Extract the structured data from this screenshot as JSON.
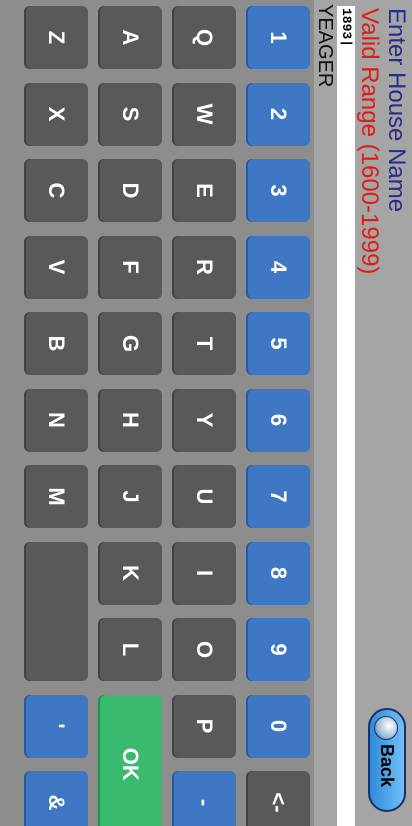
{
  "prompt": {
    "title": "Enter House Name",
    "range": "Valid Range (1600-1999)"
  },
  "entry": {
    "value": "1893|"
  },
  "result": "YEAGER",
  "back_label": "Back",
  "keys": {
    "num": [
      "1",
      "2",
      "3",
      "4",
      "5",
      "6",
      "7",
      "8",
      "9",
      "0"
    ],
    "backspace": "<-",
    "row_q": [
      "Q",
      "W",
      "E",
      "R",
      "T",
      "Y",
      "U",
      "I",
      "O",
      "P"
    ],
    "minus": "-",
    "row_a": [
      "A",
      "S",
      "D",
      "F",
      "G",
      "H",
      "J",
      "K",
      "L"
    ],
    "ok": "OK",
    "row_z": [
      "Z",
      "X",
      "C",
      "V",
      "B",
      "N",
      "M"
    ],
    "apostrophe": "'",
    "ampersand": "&"
  },
  "colors": {
    "key": "#595959",
    "accent_key": "#3e77c3",
    "ok_key": "#3aba6f",
    "title": "#2a2a8c",
    "range": "#e01b12"
  }
}
